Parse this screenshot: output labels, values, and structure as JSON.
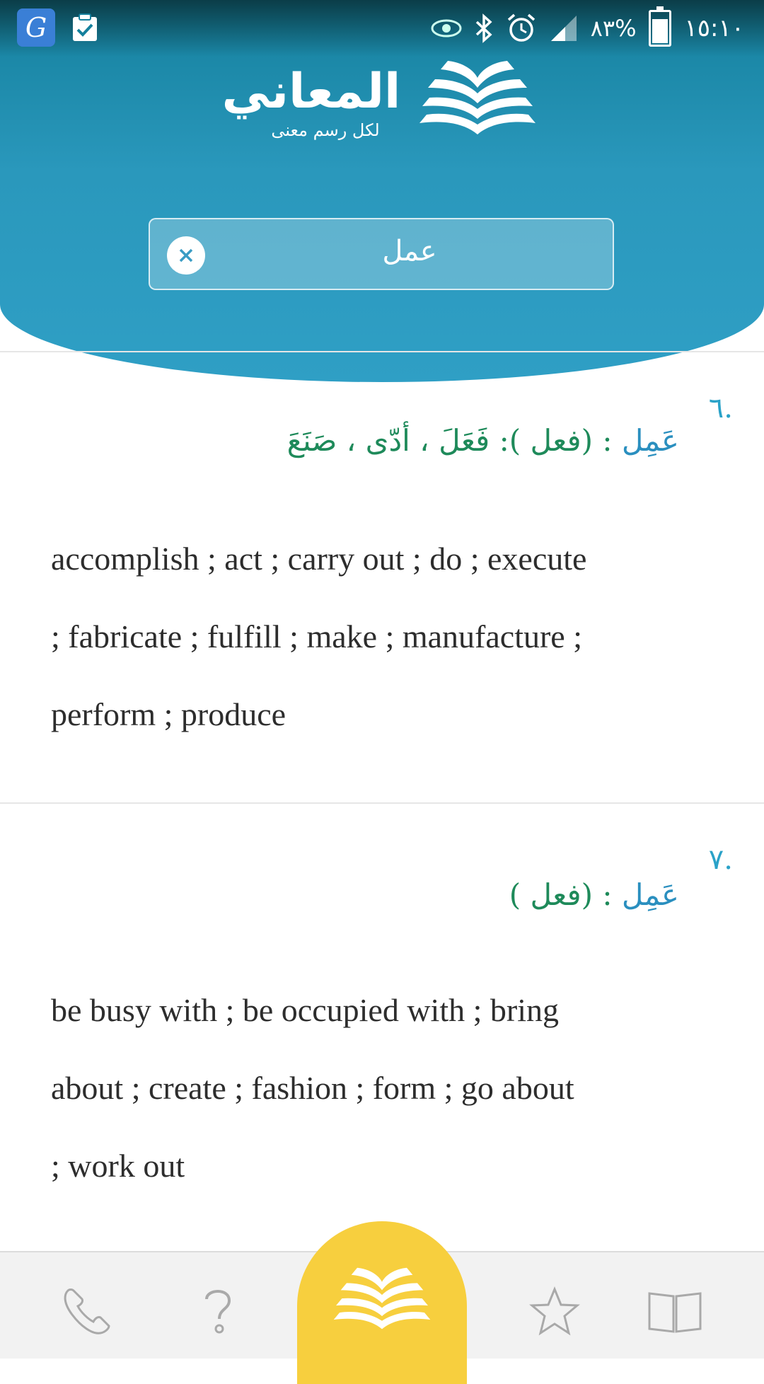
{
  "status_bar": {
    "time": "١٥:١٠",
    "battery": "٨٣%",
    "battery_level": 0.83,
    "icons": [
      "grammarly-icon",
      "clipboard-check-icon",
      "eye-icon",
      "bluetooth-icon",
      "alarm-icon",
      "signal-icon",
      "battery-icon"
    ]
  },
  "header": {
    "logo_title": "المعاني",
    "logo_tagline": "لكل رسم معنى",
    "logo_icon": "open-book-icon"
  },
  "search": {
    "value": "عمل",
    "clear_icon": "close-icon"
  },
  "entries": [
    {
      "number": "٦.",
      "head": "عَمِل",
      "definition": " : (فعل ): فَعَلَ ، أدّى ، صَنَعَ",
      "english": "accomplish ; act ; carry out ; do ; execute ; fabricate ; fulfill ; make ; manufacture ; perform ; produce",
      "english_lines": [
        "accomplish ; act ; carry out ; do ; execute",
        "; fabricate ; fulfill ; make ; manufacture ;",
        "perform ; produce"
      ]
    },
    {
      "number": "٧.",
      "head": "عَمِل",
      "definition": " : (فعل )",
      "english": "be busy with ; be occupied with ; bring about ; create ; fashion ; form ; go about ; work out",
      "english_lines": [
        "be busy with ; be occupied with ; bring",
        "about ; create ; fashion ; form ; go about",
        "; work out"
      ]
    }
  ],
  "bottom_nav": {
    "items": [
      "phone-icon",
      "help-icon",
      "dictionary-home-icon",
      "star-icon",
      "book-icon"
    ],
    "center_color": "#f7cf3e"
  },
  "colors": {
    "header_blue": "#2a98bc",
    "arabic_green": "#1e8a5a",
    "head_blue": "#2a8fbf"
  }
}
